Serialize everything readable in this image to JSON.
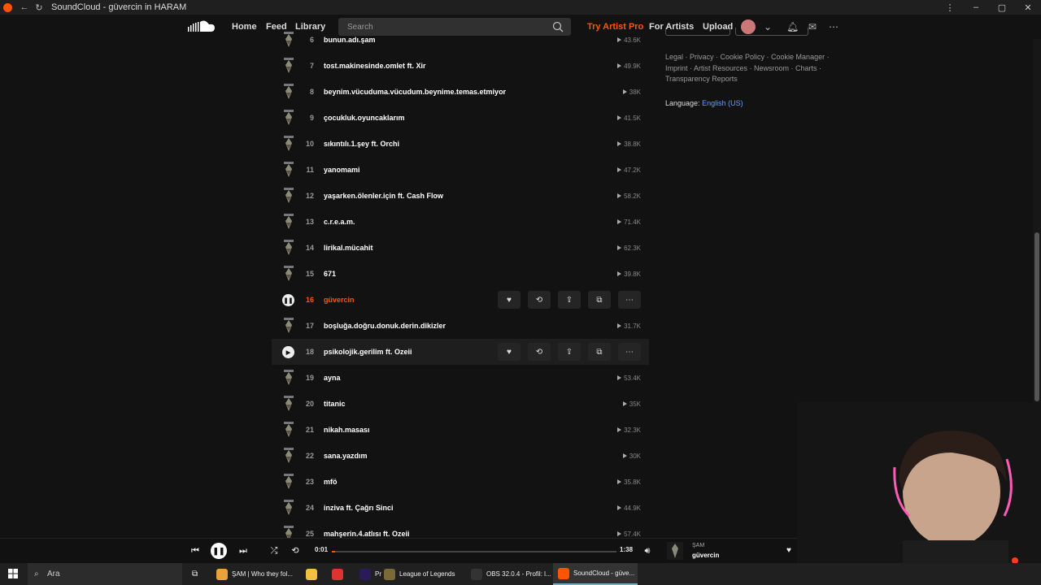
{
  "browser": {
    "tab_title": "SoundCloud - güvercin in HARAM"
  },
  "header": {
    "nav": [
      "Home",
      "Feed",
      "Library"
    ],
    "search_placeholder": "Search",
    "try_pro": "Try Artist Pro",
    "for_artists": "For Artists",
    "upload": "Upload"
  },
  "tracks": [
    {
      "num": "6",
      "title": "bunun.adı.şam",
      "plays": "43.6K"
    },
    {
      "num": "7",
      "title": "tost.makinesinde.omlet ft. Xir",
      "plays": "49.9K"
    },
    {
      "num": "8",
      "title": "beynim.vücuduma.vücudum.beynime.temas.etmiyor",
      "plays": "38K"
    },
    {
      "num": "9",
      "title": "çocukluk.oyuncaklarım",
      "plays": "41.5K"
    },
    {
      "num": "10",
      "title": "sıkıntılı.1.şey ft. Orchi",
      "plays": "38.8K"
    },
    {
      "num": "11",
      "title": "yanomami",
      "plays": "47.2K"
    },
    {
      "num": "12",
      "title": "yaşarken.ölenler.için ft. Cash Flow",
      "plays": "58.2K"
    },
    {
      "num": "13",
      "title": "c.r.e.a.m.",
      "plays": "71.4K"
    },
    {
      "num": "14",
      "title": "lirikal.mücahit",
      "plays": "62.3K"
    },
    {
      "num": "15",
      "title": "671",
      "plays": "39.8K"
    },
    {
      "num": "16",
      "title": "güvercin",
      "plays": ""
    },
    {
      "num": "17",
      "title": "boşluğa.doğru.donuk.derin.dikizler",
      "plays": "31.7K"
    },
    {
      "num": "18",
      "title": "psikolojik.gerilim ft. Ozeii",
      "plays": ""
    },
    {
      "num": "19",
      "title": "ayna",
      "plays": "53.4K"
    },
    {
      "num": "20",
      "title": "titanic",
      "plays": "35K"
    },
    {
      "num": "21",
      "title": "nikah.masası",
      "plays": "32.3K"
    },
    {
      "num": "22",
      "title": "sana.yazdım",
      "plays": "30K"
    },
    {
      "num": "23",
      "title": "mfö",
      "plays": "35.8K"
    },
    {
      "num": "24",
      "title": "inziva ft. Çağrı Sinci",
      "plays": "44.9K"
    },
    {
      "num": "25",
      "title": "mahşerin.4.atlısı ft. Ozeii",
      "plays": "57.4K"
    }
  ],
  "sidebar": {
    "links_line1": "Legal · Privacy · Cookie Policy · Cookie Manager ·",
    "links_line2": "Imprint · Artist Resources · Newsroom · Charts ·",
    "links_line3": "Transparency Reports",
    "language_label": "Language:",
    "language_value": "English (US)"
  },
  "player": {
    "current_time": "0:01",
    "total_time": "1:38",
    "progress": 0.01,
    "artist": "ŞAM",
    "title": "güvercin"
  },
  "taskbar": {
    "search": "Ara",
    "apps": [
      {
        "label": "ŞAM | Who they fol...",
        "color": "#e8a33d"
      },
      {
        "label": "",
        "color": "#f0c040"
      },
      {
        "label": "",
        "color": "#d33"
      },
      {
        "label": "Pr",
        "color": "#2a1a5a"
      },
      {
        "label": "League of Legends",
        "color": "#7a6a3a"
      },
      {
        "label": "OBS 32.0.4 - Profil: l...",
        "color": "#333"
      },
      {
        "label": "SoundCloud - güve...",
        "color": "#ff5500"
      }
    ]
  },
  "colors": {
    "accent": "#ff5500",
    "link": "#6e9bff",
    "background": "#121212"
  }
}
